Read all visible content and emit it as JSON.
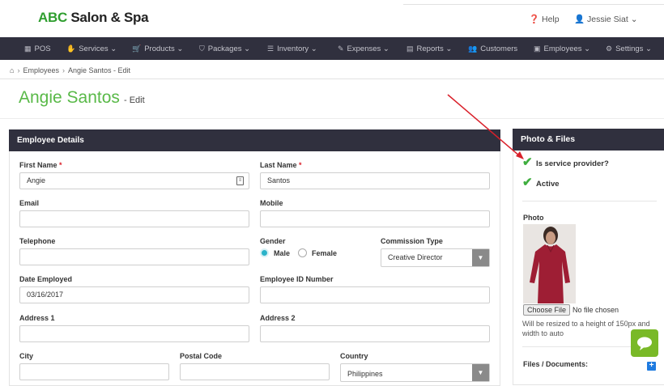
{
  "brand": {
    "abc": "ABC",
    "rest": "Salon & Spa"
  },
  "header": {
    "help": "Help",
    "user": "Jessie Siat"
  },
  "nav": {
    "items": [
      {
        "label": "POS",
        "icon": "pos-icon",
        "glyph": "▦"
      },
      {
        "label": "Services",
        "icon": "hand-icon",
        "glyph": "✋",
        "caret": "⌄"
      },
      {
        "label": "Products",
        "icon": "cart-icon",
        "glyph": "🛒",
        "caret": "⌄"
      },
      {
        "label": "Packages",
        "icon": "tags-icon",
        "glyph": "⛉",
        "caret": "⌄"
      },
      {
        "label": "Inventory",
        "icon": "list-icon",
        "glyph": "☰",
        "caret": "⌄"
      },
      {
        "label": "Expenses",
        "icon": "edit-icon",
        "glyph": "✎",
        "caret": "⌄"
      },
      {
        "label": "Reports",
        "icon": "chart-icon",
        "glyph": "▤",
        "caret": "⌄"
      },
      {
        "label": "Customers",
        "icon": "users-icon",
        "glyph": "👥"
      },
      {
        "label": "Employees",
        "icon": "briefcase-icon",
        "glyph": "▣",
        "caret": "⌄"
      },
      {
        "label": "Settings",
        "icon": "gear-icon",
        "glyph": "⚙",
        "caret": "⌄"
      }
    ]
  },
  "breadcrumb": {
    "home_icon": "home-icon",
    "items": [
      "Employees",
      "Angie Santos - Edit"
    ]
  },
  "page": {
    "title": "Angie Santos",
    "subtitle": "- Edit"
  },
  "employee_details": {
    "heading": "Employee Details",
    "first_name": {
      "label": "First Name",
      "value": "Angie"
    },
    "last_name": {
      "label": "Last Name",
      "value": "Santos"
    },
    "email": {
      "label": "Email",
      "value": ""
    },
    "mobile": {
      "label": "Mobile",
      "value": ""
    },
    "telephone": {
      "label": "Telephone",
      "value": ""
    },
    "gender": {
      "label": "Gender",
      "options": [
        "Male",
        "Female"
      ],
      "selected": "Male"
    },
    "commission_type": {
      "label": "Commission Type",
      "value": "Creative Director"
    },
    "date_employed": {
      "label": "Date Employed",
      "value": "03/16/2017"
    },
    "employee_id": {
      "label": "Employee ID Number",
      "value": ""
    },
    "address1": {
      "label": "Address 1",
      "value": ""
    },
    "address2": {
      "label": "Address 2",
      "value": ""
    },
    "city": {
      "label": "City",
      "value": ""
    },
    "postal_code": {
      "label": "Postal Code",
      "value": ""
    },
    "country": {
      "label": "Country",
      "value": "Philippines"
    }
  },
  "photo_files": {
    "heading": "Photo & Files",
    "service_provider": "Is service provider?",
    "active": "Active",
    "photo_label": "Photo",
    "choose_file": "Choose File",
    "no_file": "No file chosen",
    "note": "Will be resized to a height of 150px and width to auto",
    "files_label": "Files / Documents:"
  },
  "colors": {
    "brand_green": "#2f9e2f",
    "nav_bg": "#30303e",
    "title_green": "#59b948",
    "arrow_red": "#d9202a",
    "check_green": "#3fae3f"
  }
}
